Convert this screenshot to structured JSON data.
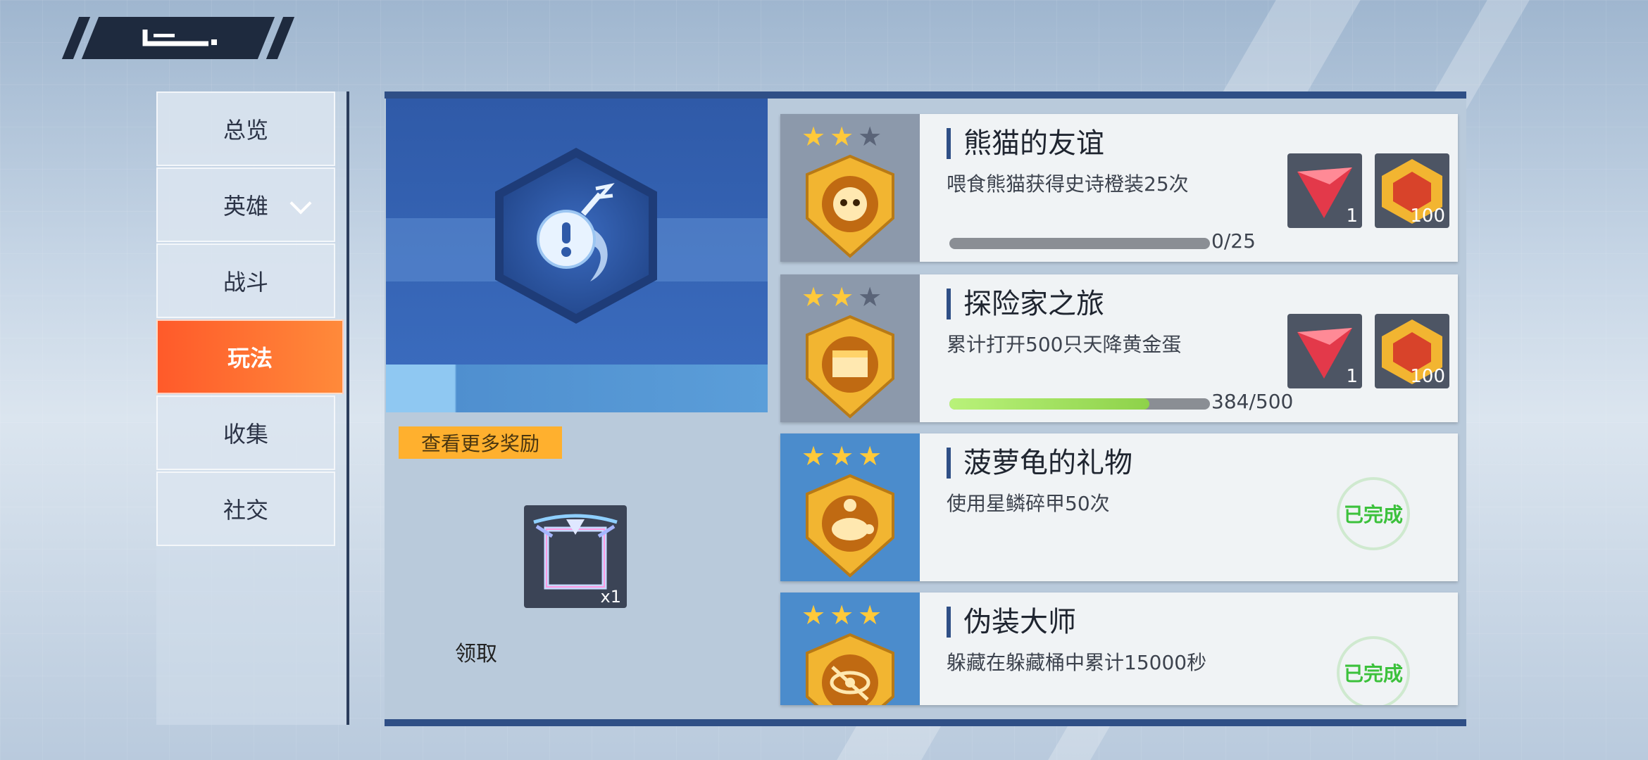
{
  "menu": {
    "items": [
      {
        "label": "总览"
      },
      {
        "label": "英雄"
      },
      {
        "label": "战斗"
      },
      {
        "label": "玩法"
      },
      {
        "label": "收集"
      },
      {
        "label": "社交"
      }
    ],
    "active_index": 3
  },
  "reward_panel": {
    "more_rewards_label": "查看更多奖励",
    "reward_qty": "x1",
    "claim_label": "领取"
  },
  "achievements": [
    {
      "title": "熊猫的友谊",
      "desc": "喂食熊猫获得史诗橙装25次",
      "stars": 2,
      "badge_icon": "panda-badge-icon",
      "progress_text": "0/25",
      "progress": 0,
      "rewards": [
        {
          "icon": "red-gem-icon",
          "count": "1"
        },
        {
          "icon": "gold-token-icon",
          "count": "100"
        }
      ]
    },
    {
      "title": "探险家之旅",
      "desc": "累计打开500只天降黄金蛋",
      "stars": 2,
      "badge_icon": "chest-badge-icon",
      "progress_text": "384/500",
      "progress": 0.768,
      "rewards": [
        {
          "icon": "red-gem-icon",
          "count": "1"
        },
        {
          "icon": "gold-token-icon",
          "count": "100"
        }
      ]
    },
    {
      "title": "菠萝龟的礼物",
      "desc": "使用星鳞碎甲50次",
      "stars": 3,
      "badge_icon": "turtle-badge-icon",
      "status": "已完成"
    },
    {
      "title": "伪装大师",
      "desc": "躲藏在躲藏桶中累计15000秒",
      "stars": 3,
      "badge_icon": "eye-badge-icon",
      "status": "已完成"
    }
  ],
  "colors": {
    "active_tab": "#ff6a30",
    "panel_blue": "#2f5aa8",
    "complete_green": "#3cc13c",
    "star_gold": "#ffc93a"
  }
}
